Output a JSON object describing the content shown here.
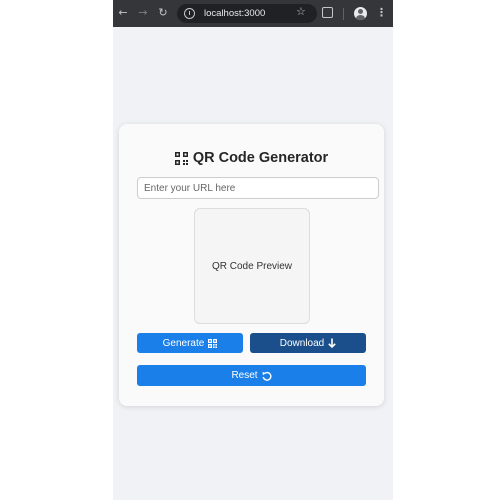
{
  "browser": {
    "url": "localhost:3000"
  },
  "app": {
    "title": "QR Code Generator",
    "url_input_placeholder": "Enter your URL here",
    "url_input_value": "",
    "preview_text": "QR Code Preview",
    "generate_label": "Generate",
    "download_label": "Download",
    "reset_label": "Reset"
  },
  "icons": {
    "title_icon": "qrcode-icon",
    "generate_icon": "qrcode-icon",
    "download_icon": "arrow-down-icon",
    "reset_icon": "rotate-left-icon"
  },
  "colors": {
    "primary": "#1a7fe8",
    "download": "#1b4f8c",
    "page_background": "#f0f2f5",
    "card_background": "#fafafa"
  }
}
